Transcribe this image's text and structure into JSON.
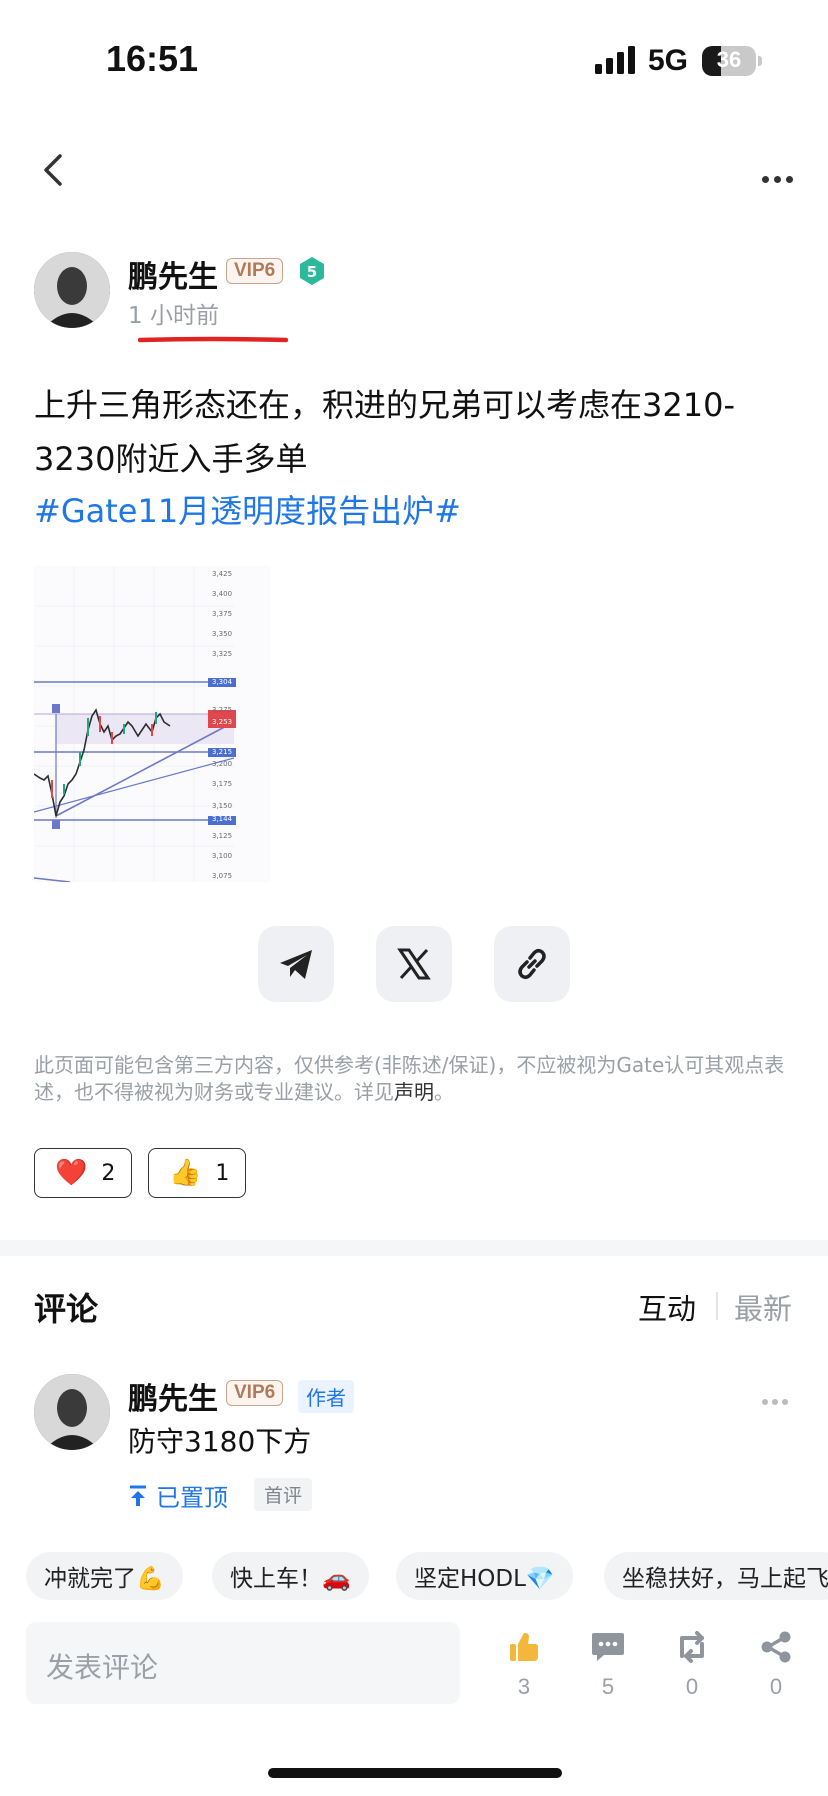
{
  "status_bar": {
    "time": "16:51",
    "network": "5G",
    "battery": "36",
    "battery_level": 0.36
  },
  "post": {
    "author": "鹏先生",
    "vip": "VIP6",
    "level": "5",
    "time": "1 小时前",
    "text": "上升三角形态还在，积进的兄弟可以考虑在3210-3230附近入手多单",
    "tag": "#Gate11月透明度报告出炉#",
    "chart_axis": [
      "3,425",
      "3,400",
      "3,375",
      "3,350",
      "3,325",
      "3,304",
      "3,275",
      "3,253",
      "3,215",
      "3,200",
      "3,175",
      "3,150",
      "3,144",
      "3,125",
      "3,100",
      "3,075"
    ]
  },
  "disclaimer": {
    "text": "此页面可能包含第三方内容，仅供参考(非陈述/保证)，不应被视为Gate认可其观点表述，也不得被视为财务或专业建议。详见",
    "link": "声明",
    "end": "。"
  },
  "reactions": [
    {
      "icon": "heart-icon",
      "emoji": "❤️",
      "count": "2"
    },
    {
      "icon": "thumbs-up-icon",
      "emoji": "👍",
      "count": "1"
    }
  ],
  "comments": {
    "title": "评论",
    "tabs": [
      "互动",
      "最新"
    ],
    "items": [
      {
        "author": "鹏先生",
        "vip": "VIP6",
        "role": "作者",
        "text": "防守3180下方",
        "pinned": "已置顶",
        "badge": "首评"
      }
    ]
  },
  "quick_replies": [
    "冲就完了💪",
    "快上车！🚗",
    "坚定HODL💎",
    "坐稳扶好，马上起飞"
  ],
  "bottom_bar": {
    "placeholder": "发表评论",
    "actions": [
      {
        "icon": "thumbs-up-icon",
        "count": "3"
      },
      {
        "icon": "comment-icon",
        "count": "5"
      },
      {
        "icon": "repost-icon",
        "count": "0"
      },
      {
        "icon": "share-icon",
        "count": "0"
      }
    ]
  },
  "colors": {
    "link": "#1f76e6",
    "muted": "#9aa0a6",
    "vip": "#b27a59",
    "level": "#2cb89a"
  }
}
